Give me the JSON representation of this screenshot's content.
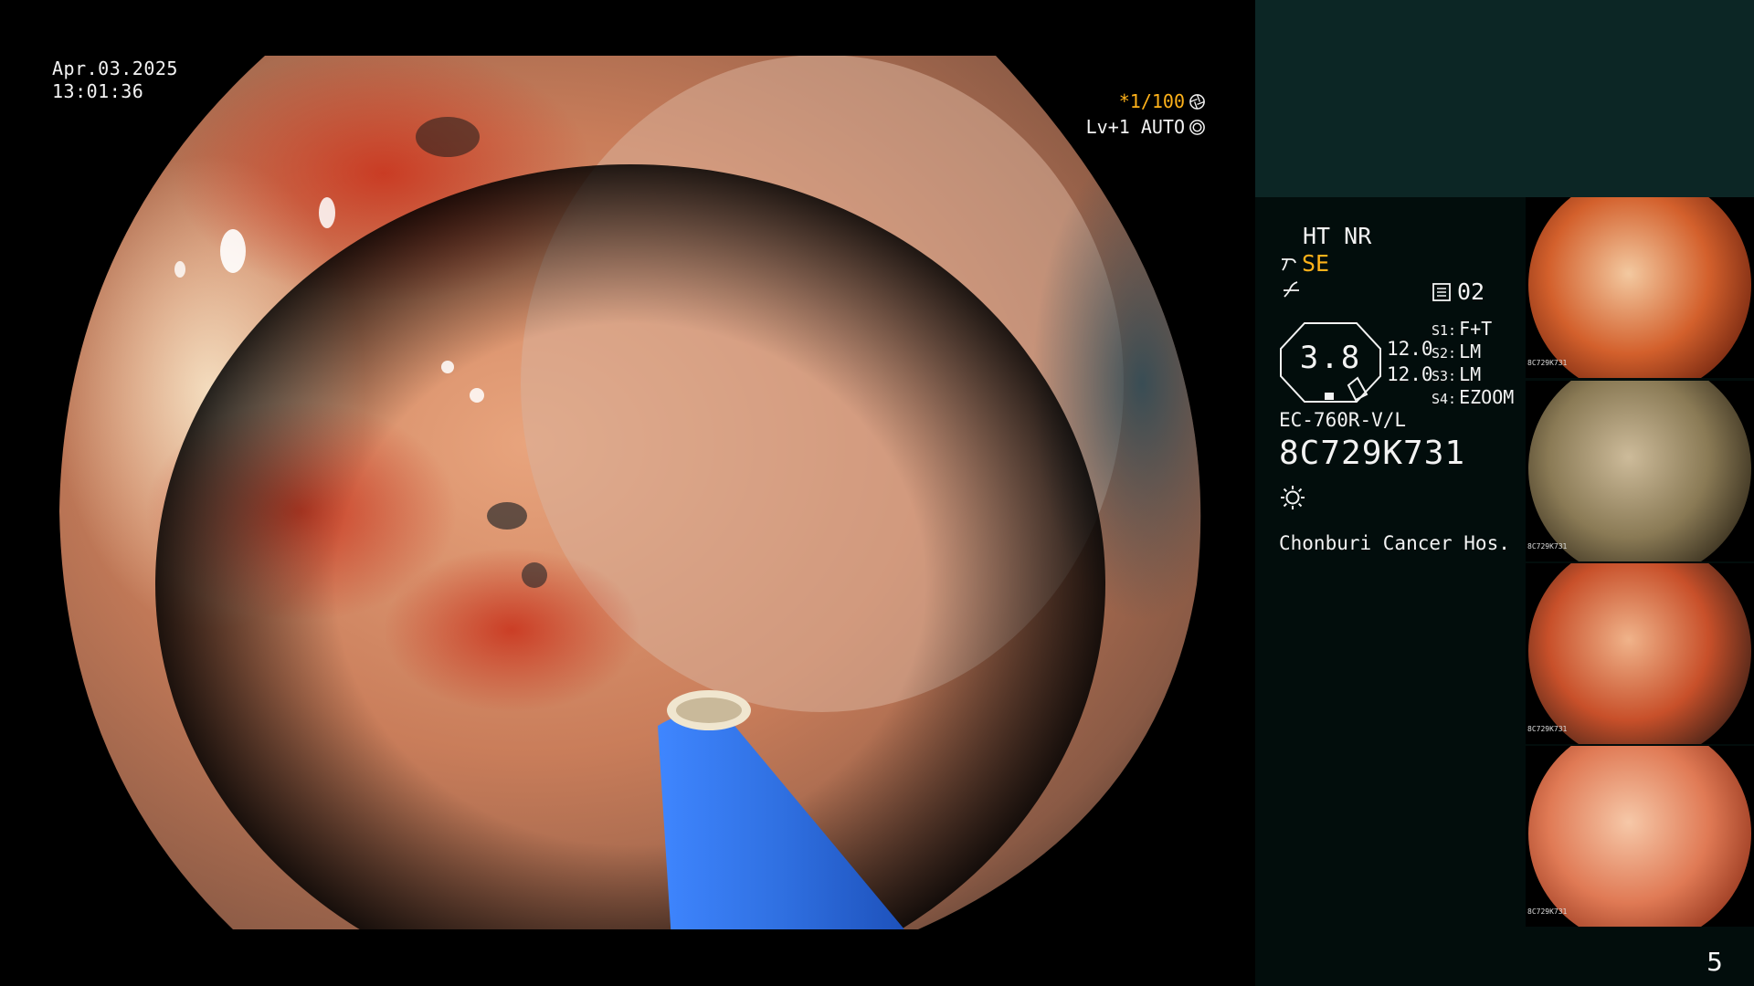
{
  "main_view": {
    "date": "Apr.03.2025",
    "time": "13:01:36",
    "shutter": "*1/100",
    "iris": "Lv+1 AUTO"
  },
  "panel": {
    "mode": "HT NR",
    "enhancement": "SE",
    "memory_label": "02",
    "zoom_value": "3.8",
    "zoom_a": "12.0",
    "zoom_b": "12.0",
    "switches": [
      {
        "key": "S1:",
        "value": "F+T"
      },
      {
        "key": "S2:",
        "value": "LM"
      },
      {
        "key": "S3:",
        "value": "LM"
      },
      {
        "key": "S4:",
        "value": "EZOOM"
      }
    ],
    "scope_model": "EC-760R-V/L",
    "scope_serial": "8C729K731",
    "hospital": "Chonburi Cancer Hos.",
    "page_number": "5"
  },
  "thumbnails": [
    {
      "serial": "8C729K731",
      "colors": [
        "#f3c9a0",
        "#d3602c",
        "#7a2a12"
      ]
    },
    {
      "serial": "8C729K731",
      "colors": [
        "#cdbb9a",
        "#8a7a55",
        "#3b3220"
      ]
    },
    {
      "serial": "8C729K731",
      "colors": [
        "#f0b38a",
        "#c8502a",
        "#4a2418"
      ]
    },
    {
      "serial": "8C729K731",
      "colors": [
        "#f6c8a8",
        "#e07a55",
        "#9c3c22"
      ]
    }
  ],
  "colors": {
    "accent_orange": "#ffb21a",
    "panel_background": "#020d0c",
    "panel_header": "#0c2625",
    "tool_blue": "#2f6fe0"
  },
  "icons": {
    "shutter": "aperture-icon",
    "iris": "iris-icon",
    "enhancement": "gamma-icon",
    "structure": "structure-icon",
    "memory": "memory-card-icon",
    "light": "sun-icon"
  }
}
